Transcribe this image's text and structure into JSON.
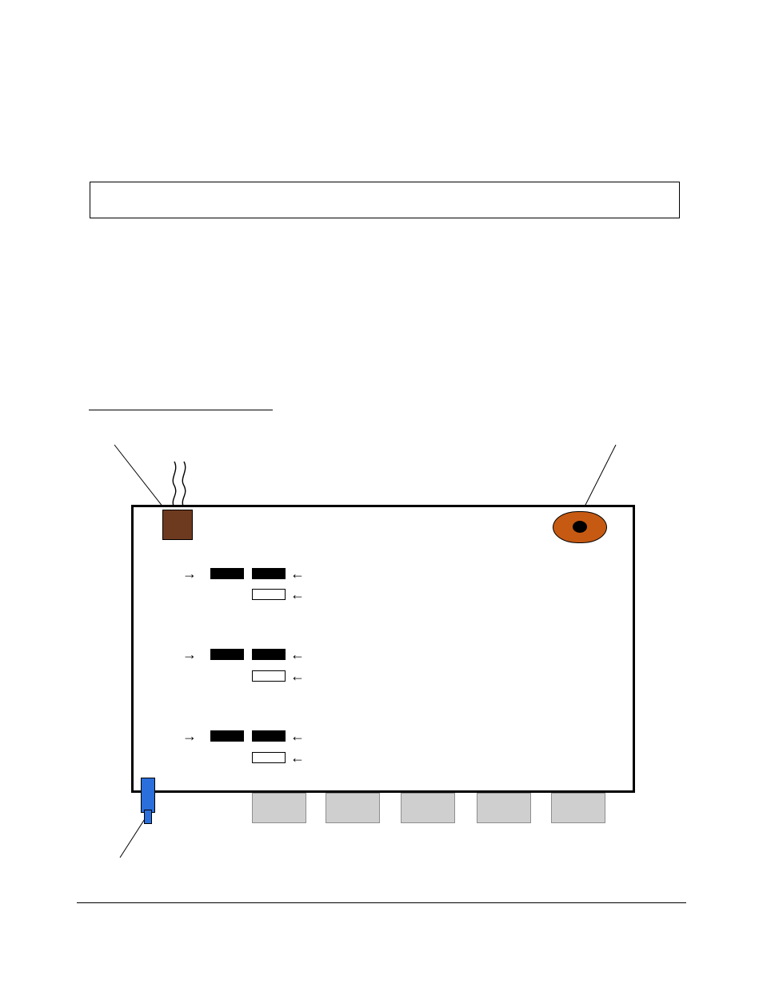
{
  "title_box": "",
  "section_heading": "",
  "labels": {
    "stove": "",
    "phone": "",
    "door": "",
    "desks": ""
  },
  "rows": [
    {
      "left_arrow": "→",
      "right_arrows": [
        "←",
        "←"
      ]
    },
    {
      "left_arrow": "→",
      "right_arrows": [
        "←",
        "←"
      ]
    },
    {
      "left_arrow": "→",
      "right_arrows": [
        "←",
        "←"
      ]
    }
  ],
  "colors": {
    "stove": "#6e3a1f",
    "phone": "#c65a12",
    "door": "#2a6fdc",
    "desk": "#cfcfcf"
  }
}
